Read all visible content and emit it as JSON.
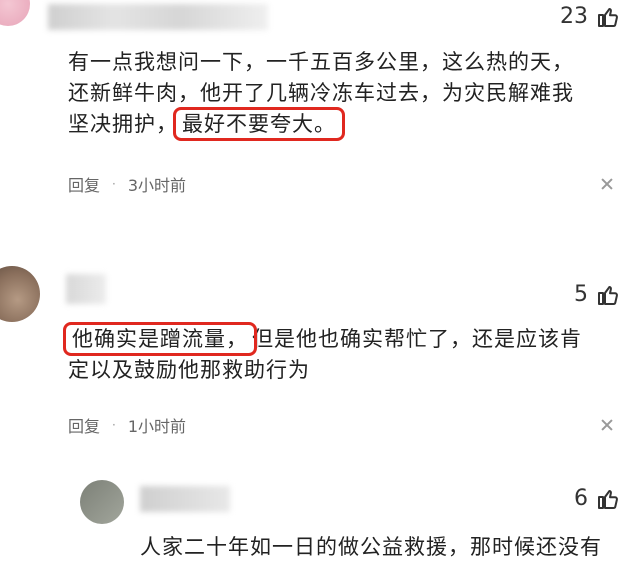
{
  "comments": [
    {
      "likes": "23",
      "text_parts": [
        "有一点我想问一下，一千五百多公里，这么热的天，",
        "还新鲜牛肉，他开了几辆冷冻车过去，为灾民解难我",
        "坚决拥护，",
        "最好不要夸大。"
      ],
      "reply_label": "回复",
      "time": "3小时前"
    },
    {
      "likes": "5",
      "text_parts": [
        "他确实是蹭流量，",
        "但是他也确实帮忙了，还是应该肯",
        "定以及鼓励他那救助行为"
      ],
      "reply_label": "回复",
      "time": "1小时前"
    },
    {
      "likes": "6",
      "text_parts": [
        "人家二十年如一日的做公益救援，那时候还没有"
      ]
    }
  ],
  "icons": {
    "like": "thumbs-up-icon",
    "close": "close-icon"
  },
  "colors": {
    "highlight_border": "#e0281f",
    "meta_text": "#666666"
  }
}
